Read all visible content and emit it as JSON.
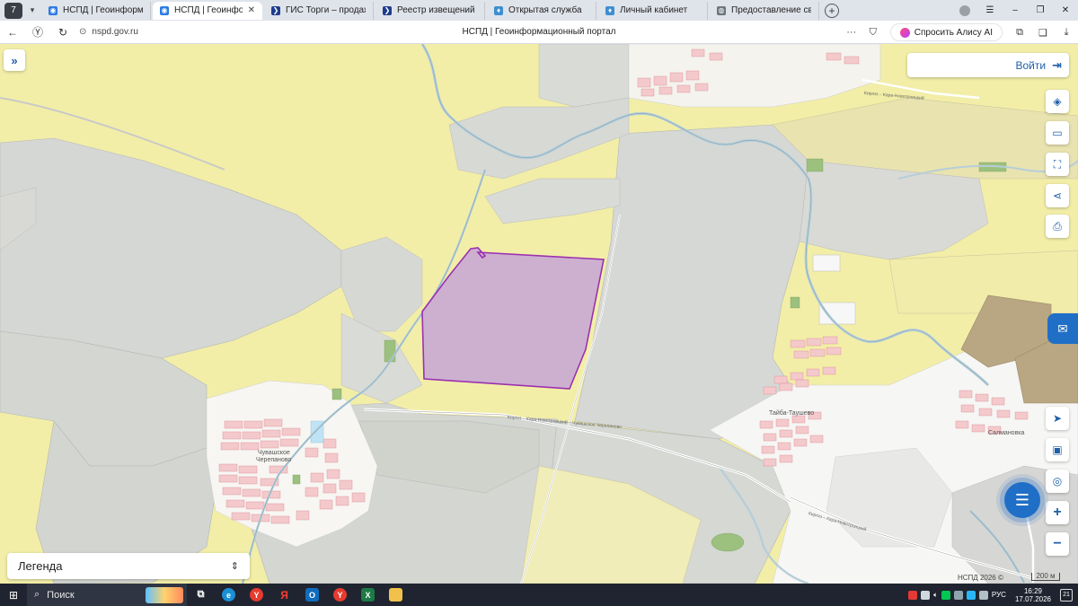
{
  "browser": {
    "tabs": [
      {
        "title": "НСПД | Геоинформационный",
        "icon": "nspd-icon",
        "active": false
      },
      {
        "title": "НСПД | Геоинформацио",
        "icon": "nspd-icon",
        "active": true
      },
      {
        "title": "ГИС Торги – продажи гос",
        "icon": "gis-torgi-icon",
        "active": false
      },
      {
        "title": "Реестр извещений",
        "icon": "gis-torgi-icon",
        "active": false
      },
      {
        "title": "Открытая служба",
        "icon": "gerb-icon",
        "active": false
      },
      {
        "title": "Личный кабинет",
        "icon": "gerb-icon",
        "active": false
      },
      {
        "title": "Предоставление сведени",
        "icon": "globe-icon",
        "active": false
      }
    ],
    "tab_counter": "7",
    "url": "nspd.gov.ru",
    "page_title": "НСПД | Геоинформационный портал",
    "alice_label": "Спросить Алису AI"
  },
  "map": {
    "login_label": "Войти",
    "legend_label": "Легенда",
    "copyright": "НСПД 2026 ©",
    "scale_label": "200 м",
    "place_labels": [
      {
        "text": "Чувашское"
      },
      {
        "text": "Черепаново"
      },
      {
        "text": "Тайба-Таушево"
      },
      {
        "text": "Салмановка"
      }
    ],
    "road_label": "Киргиз – Кара-Новотроицкий – Чувашское Черепаново",
    "road_label_top": "Киргиз – Кара-Новотроицкий",
    "road_label_right": "Киргиз – Кара-Новотроицкий",
    "colors": {
      "selected_parcel_fill": "#c9a9d4",
      "selected_parcel_stroke": "#9b30b0",
      "accent": "#1f6fc7"
    }
  },
  "taskbar": {
    "search_label": "Поиск",
    "language": "РУС",
    "time": "16:29",
    "date": "17.07.2026",
    "notifications": "21"
  }
}
